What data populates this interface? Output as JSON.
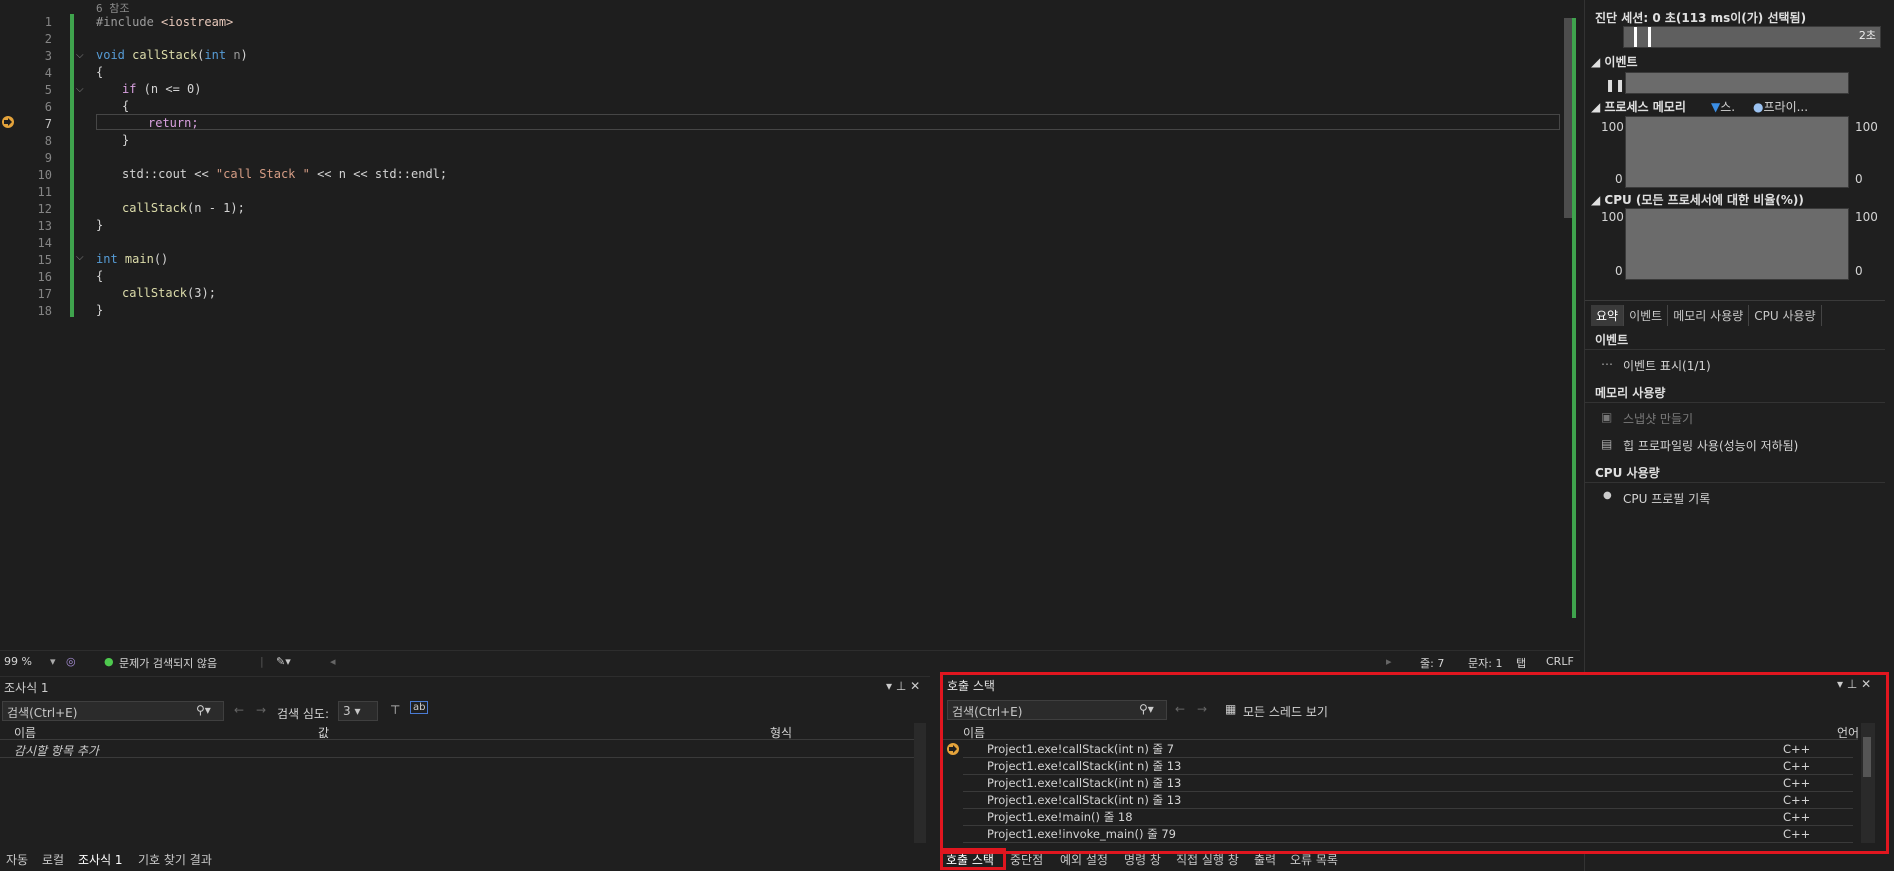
{
  "editor": {
    "ref_count_label": "6 참조",
    "line_numbers": [
      "1",
      "2",
      "3",
      "4",
      "5",
      "6",
      "7",
      "8",
      "9",
      "10",
      "11",
      "12",
      "13",
      "14",
      "15",
      "16",
      "17",
      "18"
    ],
    "current_line": "7",
    "code": {
      "l1_a": "#include ",
      "l1_b": "<iostream>",
      "l3_kw": "void",
      "l3_fn": "callStack",
      "l3_p": "(",
      "l3_int": "int",
      "l3_n": " n",
      "l3_e": ")",
      "l4": "{",
      "l5_if": "if",
      "l5_rest": " (n <= 0)",
      "l6": "{",
      "l7": "return;",
      "l8": "}",
      "l10_a": "std::cout << ",
      "l10_str": "\"call Stack \"",
      "l10_b": " << n << std::endl;",
      "l12_fn": "callStack",
      "l12_rest": "(n - 1);",
      "l13": "}",
      "l15_kw": "int",
      "l15_fn": " main",
      "l15_rest": "()",
      "l16": "{",
      "l17_fn": "callStack",
      "l17_rest": "(3);",
      "l18": "}"
    }
  },
  "status": {
    "zoom": "99 %",
    "issues": "문제가 검색되지 않음",
    "line": "줄: 7",
    "char": "문자: 1",
    "tab": "탭",
    "eol": "CRLF"
  },
  "diagnostics": {
    "session": "진단 세션: 0 초(113 ms이(가) 선택됨)",
    "timeline_label": "2초",
    "events_header": "이벤트",
    "memory_header": "프로세스 메모리",
    "memory_legend_1": "스.",
    "memory_legend_2": "프라이...",
    "mem_max_left": "100",
    "mem_min_left": "0",
    "mem_max_right": "100",
    "mem_min_right": "0",
    "cpu_header": "CPU (모든 프로세서에 대한 비율(%))",
    "cpu_max_left": "100",
    "cpu_min_left": "0",
    "cpu_max_right": "100",
    "cpu_min_right": "0",
    "tabs": [
      "요약",
      "이벤트",
      "메모리 사용량",
      "CPU 사용량"
    ],
    "sec_events": "이벤트",
    "show_events": "이벤트 표시(1/1)",
    "sec_memory": "메모리 사용량",
    "snapshot": "스냅샷 만들기",
    "heap_profiling": "힙 프로파일링 사용(성능이 저하됨)",
    "sec_cpu": "CPU 사용량",
    "cpu_profile": "CPU 프로필 기록"
  },
  "watch": {
    "title": "조사식 1",
    "search_placeholder": "검색(Ctrl+E)",
    "depth_label": "검색 심도:",
    "depth_value": "3",
    "col_name": "이름",
    "col_value": "값",
    "col_type": "형식",
    "add_item": "감시할 항목 추가"
  },
  "callstack": {
    "title": "호출 스택",
    "search_placeholder": "검색(Ctrl+E)",
    "all_threads": "모든 스레드 보기",
    "col_name": "이름",
    "col_lang": "언어",
    "rows": [
      {
        "name": "Project1.exe!callStack(int n) 줄 7",
        "lang": "C++"
      },
      {
        "name": "Project1.exe!callStack(int n) 줄 13",
        "lang": "C++"
      },
      {
        "name": "Project1.exe!callStack(int n) 줄 13",
        "lang": "C++"
      },
      {
        "name": "Project1.exe!callStack(int n) 줄 13",
        "lang": "C++"
      },
      {
        "name": "Project1.exe!main() 줄 18",
        "lang": "C++"
      },
      {
        "name": "Project1.exe!invoke_main() 줄 79",
        "lang": "C++"
      }
    ]
  },
  "bottom_tabs_left": [
    "자동",
    "로컬",
    "조사식 1",
    "기호 찾기 결과"
  ],
  "bottom_tabs_right": [
    "호출 스택",
    "중단점",
    "예외 설정",
    "명령 창",
    "직접 실행 창",
    "출력",
    "오류 목록"
  ],
  "colors": {
    "highlight": "#e0161f",
    "change_bar": "#3fa34d",
    "accent": "#007acc"
  }
}
